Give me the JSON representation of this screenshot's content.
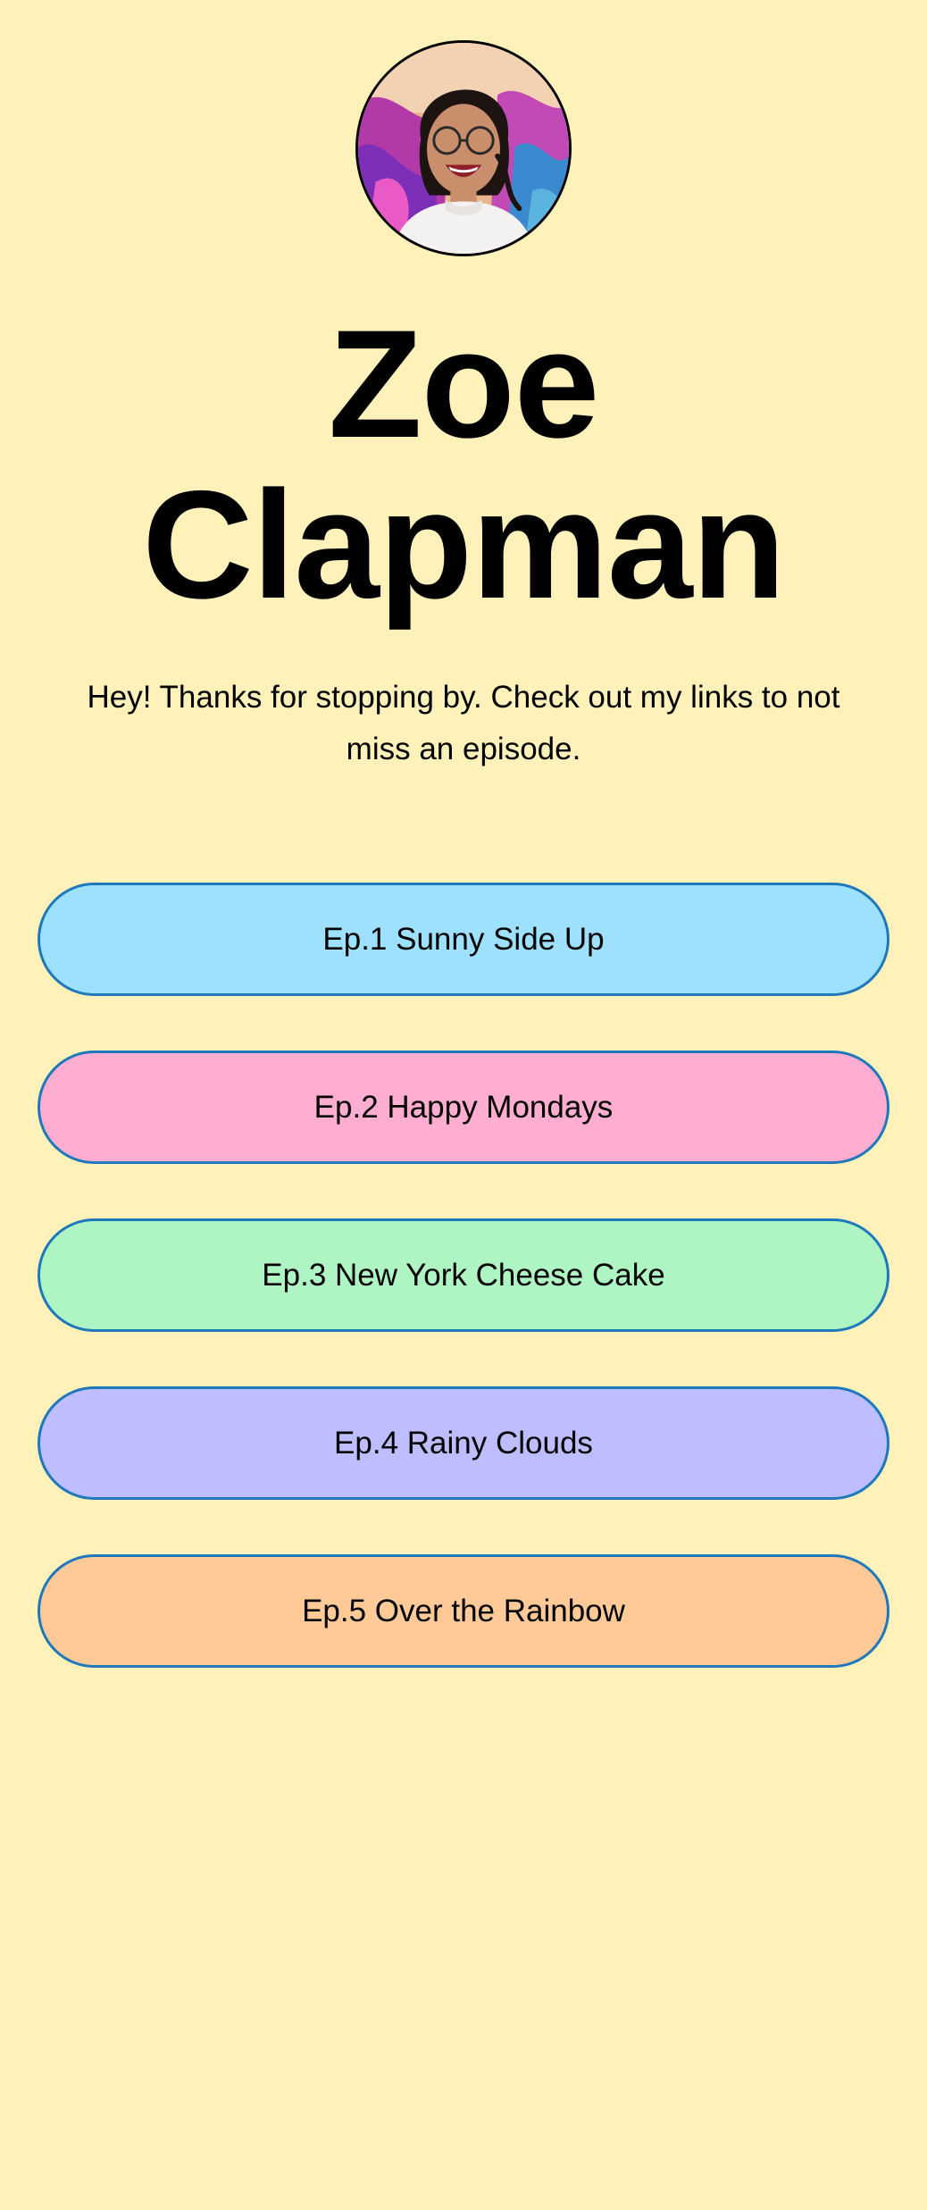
{
  "profile": {
    "avatar_icon": "profile-photo",
    "name_line1": "Zoe",
    "name_line2": "Clapman",
    "bio": "Hey! Thanks for stopping by. Check out my links to not miss an episode."
  },
  "links": [
    {
      "label": "Ep.1 Sunny Side Up",
      "color": "#9DE1FE"
    },
    {
      "label": "Ep.2 Happy Mondays",
      "color": "#FFADD0"
    },
    {
      "label": "Ep.3 New York Cheese Cake",
      "color": "#AFF5C4"
    },
    {
      "label": "Ep.4 Rainy Clouds",
      "color": "#BEBDFF"
    },
    {
      "label": "Ep.5 Over the Rainbow",
      "color": "#FFCA97"
    }
  ],
  "theme": {
    "background": "#FFF1BA",
    "button_border": "#1E78BC"
  }
}
